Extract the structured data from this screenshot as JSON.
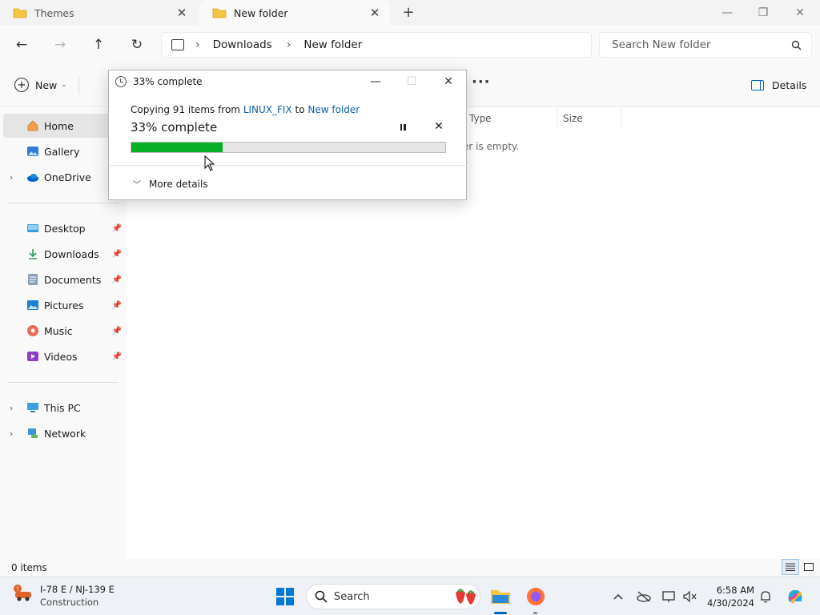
{
  "tabs": [
    {
      "label": "Themes",
      "active": false
    },
    {
      "label": "New folder",
      "active": true
    }
  ],
  "address": {
    "crumbs": [
      "Downloads",
      "New folder"
    ]
  },
  "search": {
    "placeholder": "Search New folder"
  },
  "toolbar": {
    "new_label": "New",
    "details_label": "Details"
  },
  "sidebar": {
    "group1": [
      {
        "label": "Home",
        "icon": "home-icon",
        "selected": true
      },
      {
        "label": "Gallery",
        "icon": "gallery-icon"
      },
      {
        "label": "OneDrive",
        "icon": "onedrive-icon"
      }
    ],
    "quick": [
      {
        "label": "Desktop",
        "icon": "desktop-icon"
      },
      {
        "label": "Downloads",
        "icon": "downloads-icon"
      },
      {
        "label": "Documents",
        "icon": "documents-icon"
      },
      {
        "label": "Pictures",
        "icon": "pictures-icon"
      },
      {
        "label": "Music",
        "icon": "music-icon"
      },
      {
        "label": "Videos",
        "icon": "videos-icon"
      }
    ],
    "group3": [
      {
        "label": "This PC",
        "icon": "pc-icon"
      },
      {
        "label": "Network",
        "icon": "network-icon"
      }
    ]
  },
  "columns": {
    "type": "Type",
    "size": "Size"
  },
  "empty_text": "er is empty.",
  "status": {
    "items": "0 items"
  },
  "dialog": {
    "title": "33% complete",
    "line_prefix": "Copying 91 items from",
    "source": "LINUX_FIX",
    "to": "to",
    "dest": "New folder",
    "percent_text": "33% complete",
    "progress": 0.29,
    "more_details": "More details"
  },
  "taskbar": {
    "weather_line1": "I-78 E / NJ-139 E",
    "weather_line2": "Construction",
    "search_label": "Search",
    "time": "6:58 AM",
    "date": "4/30/2024"
  },
  "colors": {
    "accent": "#0067c0",
    "progress": "#06b025",
    "link": "#0f5ea8"
  }
}
